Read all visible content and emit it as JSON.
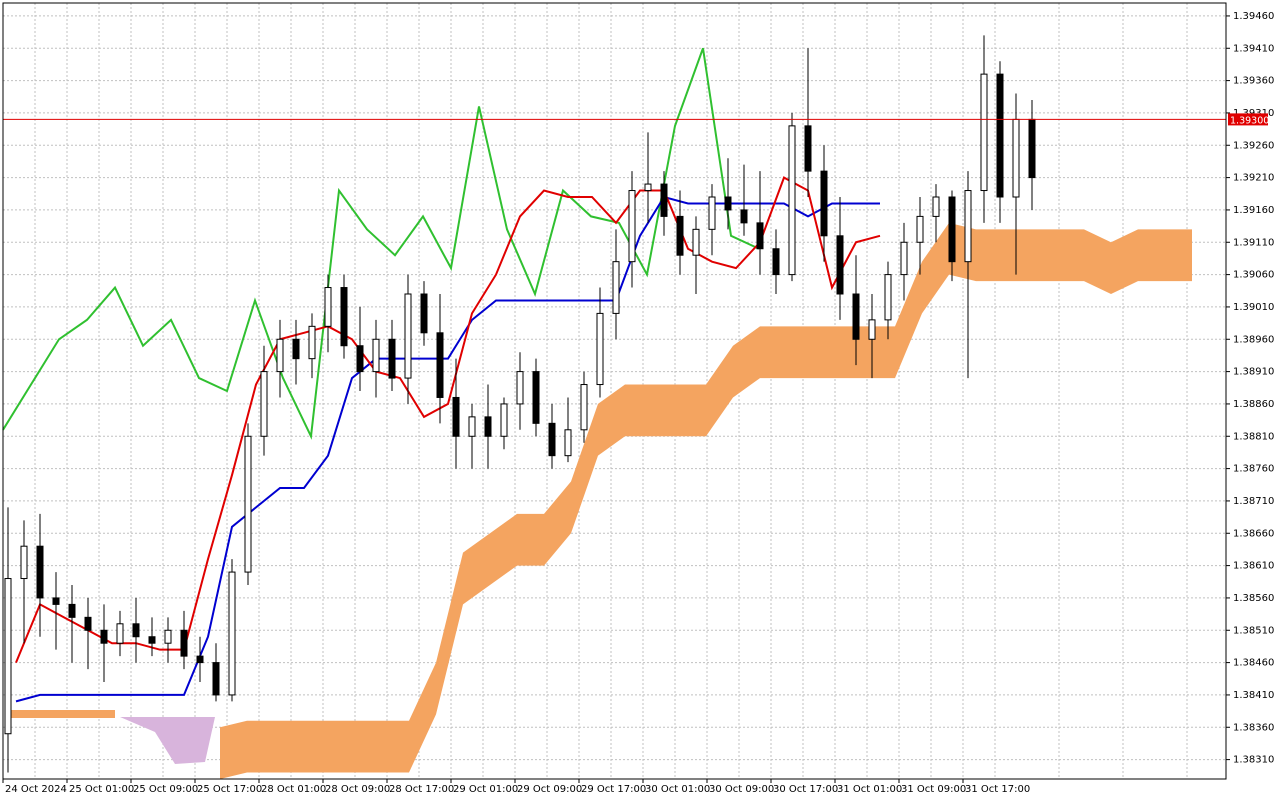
{
  "chart_data": {
    "type": "candlestick",
    "indicator": "Ichimoku Kinko Hyo",
    "current_price_label": "1.39300",
    "current_price": 1.393,
    "ylim": [
      1.3828,
      1.3948
    ],
    "y_ticks": [
      "1.39460",
      "1.39410",
      "1.39360",
      "1.39310",
      "1.39260",
      "1.39210",
      "1.39160",
      "1.39110",
      "1.39060",
      "1.39010",
      "1.38960",
      "1.38910",
      "1.38860",
      "1.38810",
      "1.38760",
      "1.38710",
      "1.38660",
      "1.38610",
      "1.38560",
      "1.38510",
      "1.38460",
      "1.38410",
      "1.38360",
      "1.38310"
    ],
    "x_ticks": [
      "24 Oct 2024",
      "25 Oct 01:00",
      "25 Oct 09:00",
      "25 Oct 17:00",
      "28 Oct 01:00",
      "28 Oct 09:00",
      "28 Oct 17:00",
      "29 Oct 01:00",
      "29 Oct 09:00",
      "29 Oct 17:00",
      "30 Oct 01:00",
      "30 Oct 09:00",
      "30 Oct 17:00",
      "31 Oct 01:00",
      "31 Oct 09:00",
      "31 Oct 17:00"
    ],
    "grid": true,
    "colors": {
      "bull_candle": "#000000",
      "bear_candle": "#000000",
      "tenkan": "#e00000",
      "kijun": "#0000d0",
      "chikou": "#30c030",
      "kumo_bull": "#f4a460",
      "kumo_bear": "#d8b4dc",
      "price_line": "#e00000",
      "grid": "#c0c0c0"
    },
    "candles": [
      [
        1.3835,
        1.387,
        1.3829,
        1.3859
      ],
      [
        1.3859,
        1.3868,
        1.3849,
        1.3864
      ],
      [
        1.3864,
        1.3869,
        1.385,
        1.3856
      ],
      [
        1.3856,
        1.386,
        1.3848,
        1.3855
      ],
      [
        1.3855,
        1.3858,
        1.3846,
        1.3853
      ],
      [
        1.3853,
        1.3856,
        1.3845,
        1.3851
      ],
      [
        1.3851,
        1.3855,
        1.3843,
        1.3849
      ],
      [
        1.3849,
        1.3854,
        1.3847,
        1.3852
      ],
      [
        1.3852,
        1.3856,
        1.3846,
        1.385
      ],
      [
        1.385,
        1.3853,
        1.3847,
        1.3849
      ],
      [
        1.3849,
        1.3853,
        1.3846,
        1.3851
      ],
      [
        1.3851,
        1.3854,
        1.3845,
        1.3847
      ],
      [
        1.3847,
        1.385,
        1.3843,
        1.3846
      ],
      [
        1.3846,
        1.3849,
        1.384,
        1.3841
      ],
      [
        1.3841,
        1.3862,
        1.384,
        1.386
      ],
      [
        1.386,
        1.3883,
        1.3858,
        1.3881
      ],
      [
        1.3881,
        1.3895,
        1.3878,
        1.3891
      ],
      [
        1.3891,
        1.3899,
        1.3887,
        1.3896
      ],
      [
        1.3896,
        1.3899,
        1.3889,
        1.3893
      ],
      [
        1.3893,
        1.39,
        1.389,
        1.3898
      ],
      [
        1.3898,
        1.3906,
        1.3894,
        1.3904
      ],
      [
        1.3904,
        1.3906,
        1.3893,
        1.3895
      ],
      [
        1.3895,
        1.3901,
        1.3888,
        1.3891
      ],
      [
        1.3891,
        1.3899,
        1.3887,
        1.3896
      ],
      [
        1.3896,
        1.3899,
        1.3888,
        1.389
      ],
      [
        1.389,
        1.3906,
        1.3886,
        1.3903
      ],
      [
        1.3903,
        1.3905,
        1.3895,
        1.3897
      ],
      [
        1.3897,
        1.3903,
        1.3883,
        1.3887
      ],
      [
        1.3887,
        1.3893,
        1.3876,
        1.3881
      ],
      [
        1.3881,
        1.3886,
        1.3876,
        1.3884
      ],
      [
        1.3884,
        1.3889,
        1.3876,
        1.3881
      ],
      [
        1.3881,
        1.3887,
        1.3879,
        1.3886
      ],
      [
        1.3886,
        1.3894,
        1.3882,
        1.3891
      ],
      [
        1.3891,
        1.3893,
        1.3881,
        1.3883
      ],
      [
        1.3883,
        1.3886,
        1.3876,
        1.3878
      ],
      [
        1.3878,
        1.3887,
        1.3877,
        1.3882
      ],
      [
        1.3882,
        1.3891,
        1.388,
        1.3889
      ],
      [
        1.3889,
        1.3904,
        1.3887,
        1.39
      ],
      [
        1.39,
        1.3913,
        1.3896,
        1.3908
      ],
      [
        1.3908,
        1.3922,
        1.3904,
        1.3919
      ],
      [
        1.3919,
        1.3928,
        1.3914,
        1.392
      ],
      [
        1.392,
        1.3922,
        1.3912,
        1.3915
      ],
      [
        1.3915,
        1.3919,
        1.3906,
        1.3909
      ],
      [
        1.3909,
        1.3915,
        1.3903,
        1.3913
      ],
      [
        1.3913,
        1.392,
        1.3909,
        1.3918
      ],
      [
        1.3918,
        1.3924,
        1.3913,
        1.3916
      ],
      [
        1.3916,
        1.3923,
        1.3912,
        1.3914
      ],
      [
        1.3914,
        1.3922,
        1.3906,
        1.391
      ],
      [
        1.391,
        1.3913,
        1.3903,
        1.3906
      ],
      [
        1.3906,
        1.3931,
        1.3905,
        1.3929
      ],
      [
        1.3929,
        1.3941,
        1.3918,
        1.3922
      ],
      [
        1.3922,
        1.3926,
        1.3908,
        1.3912
      ],
      [
        1.3912,
        1.3918,
        1.3899,
        1.3903
      ],
      [
        1.3903,
        1.3909,
        1.3892,
        1.3896
      ],
      [
        1.3896,
        1.3903,
        1.389,
        1.3899
      ],
      [
        1.3899,
        1.3908,
        1.3896,
        1.3906
      ],
      [
        1.3906,
        1.3914,
        1.3902,
        1.3911
      ],
      [
        1.3911,
        1.3918,
        1.3906,
        1.3915
      ],
      [
        1.3915,
        1.392,
        1.3911,
        1.3918
      ],
      [
        1.3918,
        1.3919,
        1.3905,
        1.3908
      ],
      [
        1.3908,
        1.3922,
        1.389,
        1.3919
      ],
      [
        1.3919,
        1.3943,
        1.3914,
        1.3937
      ],
      [
        1.3937,
        1.3939,
        1.3914,
        1.3918
      ],
      [
        1.3918,
        1.3934,
        1.3906,
        1.393
      ],
      [
        1.393,
        1.3933,
        1.3916,
        1.3921
      ]
    ],
    "tenkan_sen": [
      1.3846,
      1.3855,
      1.3853,
      1.3851,
      1.3849,
      1.3849,
      1.3848,
      1.3848,
      1.3862,
      1.3875,
      1.3889,
      1.3896,
      1.3897,
      1.3898,
      1.3896,
      1.3891,
      1.389,
      1.3884,
      1.3886,
      1.39,
      1.3906,
      1.3915,
      1.3919,
      1.3918,
      1.3918,
      1.3914,
      1.3919,
      1.3919,
      1.391,
      1.3908,
      1.3907,
      1.3911,
      1.3921,
      1.3919,
      1.3904,
      1.3911,
      1.3912
    ],
    "kijun_sen": [
      1.384,
      1.3841,
      1.3841,
      1.3841,
      1.3841,
      1.3841,
      1.3841,
      1.3841,
      1.385,
      1.3867,
      1.387,
      1.3873,
      1.3873,
      1.3878,
      1.389,
      1.3893,
      1.3893,
      1.3893,
      1.3893,
      1.3899,
      1.3902,
      1.3902,
      1.3902,
      1.3902,
      1.3902,
      1.3902,
      1.3912,
      1.3918,
      1.3917,
      1.3917,
      1.3917,
      1.3917,
      1.3917,
      1.3915,
      1.3917,
      1.3917,
      1.3917
    ],
    "chikou_span": [
      1.3882,
      1.3889,
      1.3896,
      1.3899,
      1.3904,
      1.3895,
      1.3899,
      1.389,
      1.3888,
      1.3902,
      1.389,
      1.3881,
      1.3919,
      1.3913,
      1.3909,
      1.3915,
      1.3907,
      1.3932,
      1.3913,
      1.3903,
      1.3919,
      1.3915,
      1.3914,
      1.3906,
      1.3929,
      1.3941,
      1.3912,
      1.391
    ]
  }
}
